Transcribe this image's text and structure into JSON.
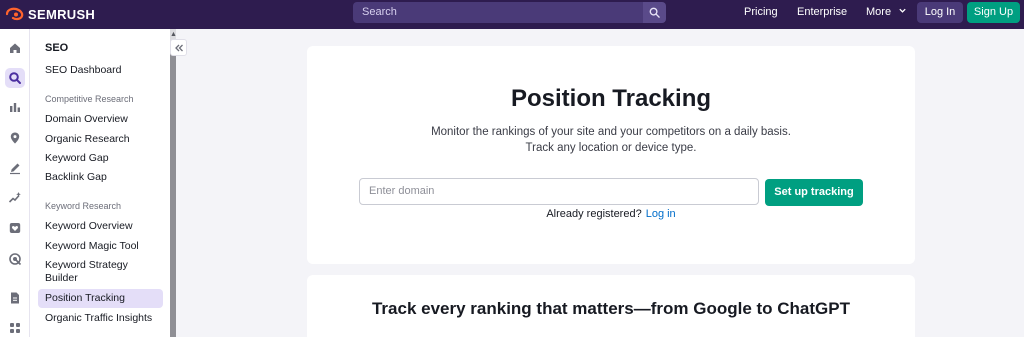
{
  "header": {
    "brand": "SEMRUSH",
    "search_placeholder": "Search",
    "nav": [
      "Pricing",
      "Enterprise",
      "More"
    ],
    "login": "Log In",
    "signup": "Sign Up",
    "colors": {
      "bar": "#2e1c4f",
      "accent": "#ff642d",
      "signup": "#009f81"
    }
  },
  "rail": {
    "icons": [
      "home-icon",
      "seo-icon",
      "chart-icon",
      "map-pin-icon",
      "pen-icon",
      "sparkle-icon",
      "shield-heart-icon",
      "target-icon",
      "document-icon",
      "grid-icon"
    ],
    "active": "seo-icon"
  },
  "sidebar": {
    "title": "SEO",
    "dashboard": "SEO Dashboard",
    "sections": [
      {
        "label": "Competitive Research",
        "items": [
          "Domain Overview",
          "Organic Research",
          "Keyword Gap",
          "Backlink Gap"
        ]
      },
      {
        "label": "Keyword Research",
        "items": [
          "Keyword Overview",
          "Keyword Magic Tool",
          "Keyword Strategy Builder"
        ]
      }
    ],
    "active_item": "Position Tracking",
    "trailing_item": "Organic Traffic Insights"
  },
  "main": {
    "title": "Position Tracking",
    "desc_line1": "Monitor the rankings of your site and your competitors on a daily basis.",
    "desc_line2": "Track any location or device type.",
    "input_placeholder": "Enter domain",
    "setup_button": "Set up tracking",
    "already": "Already registered?",
    "login_link": "Log in"
  },
  "section2": {
    "title": "Track every ranking that matters—from Google to ChatGPT"
  }
}
